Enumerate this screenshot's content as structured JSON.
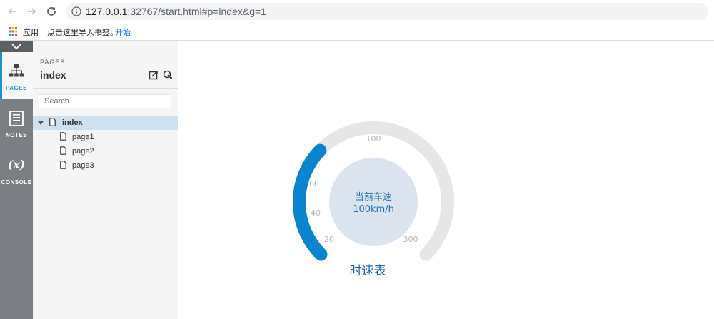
{
  "browser": {
    "url_host": "127.0.0.1",
    "url_rest": ":32767/start.html#p=index&g=1",
    "bookmarks": {
      "apps": "应用",
      "import": "点击这里导入书签。",
      "start": "开始"
    }
  },
  "rail": {
    "pages_label": "PAGES",
    "notes_label": "NOTES",
    "console_glyph": "(x)",
    "console_label": "CONSOLE"
  },
  "panel": {
    "caption": "PAGES",
    "title": "index",
    "search_placeholder": "Search",
    "tree": [
      {
        "label": "index",
        "selected": true
      },
      {
        "label": "page1"
      },
      {
        "label": "page2"
      },
      {
        "label": "page3"
      }
    ]
  },
  "gauge": {
    "title": "时速表",
    "center_line1": "当前车速",
    "center_line2": "100km/h",
    "ticks": [
      "20",
      "40",
      "60",
      "100",
      "300"
    ],
    "value_fraction": 0.33,
    "colors": {
      "track": "#e6e6e6",
      "fill": "#0b84cf",
      "center": "#dbe4ee",
      "text": "#1f6fb0"
    }
  }
}
